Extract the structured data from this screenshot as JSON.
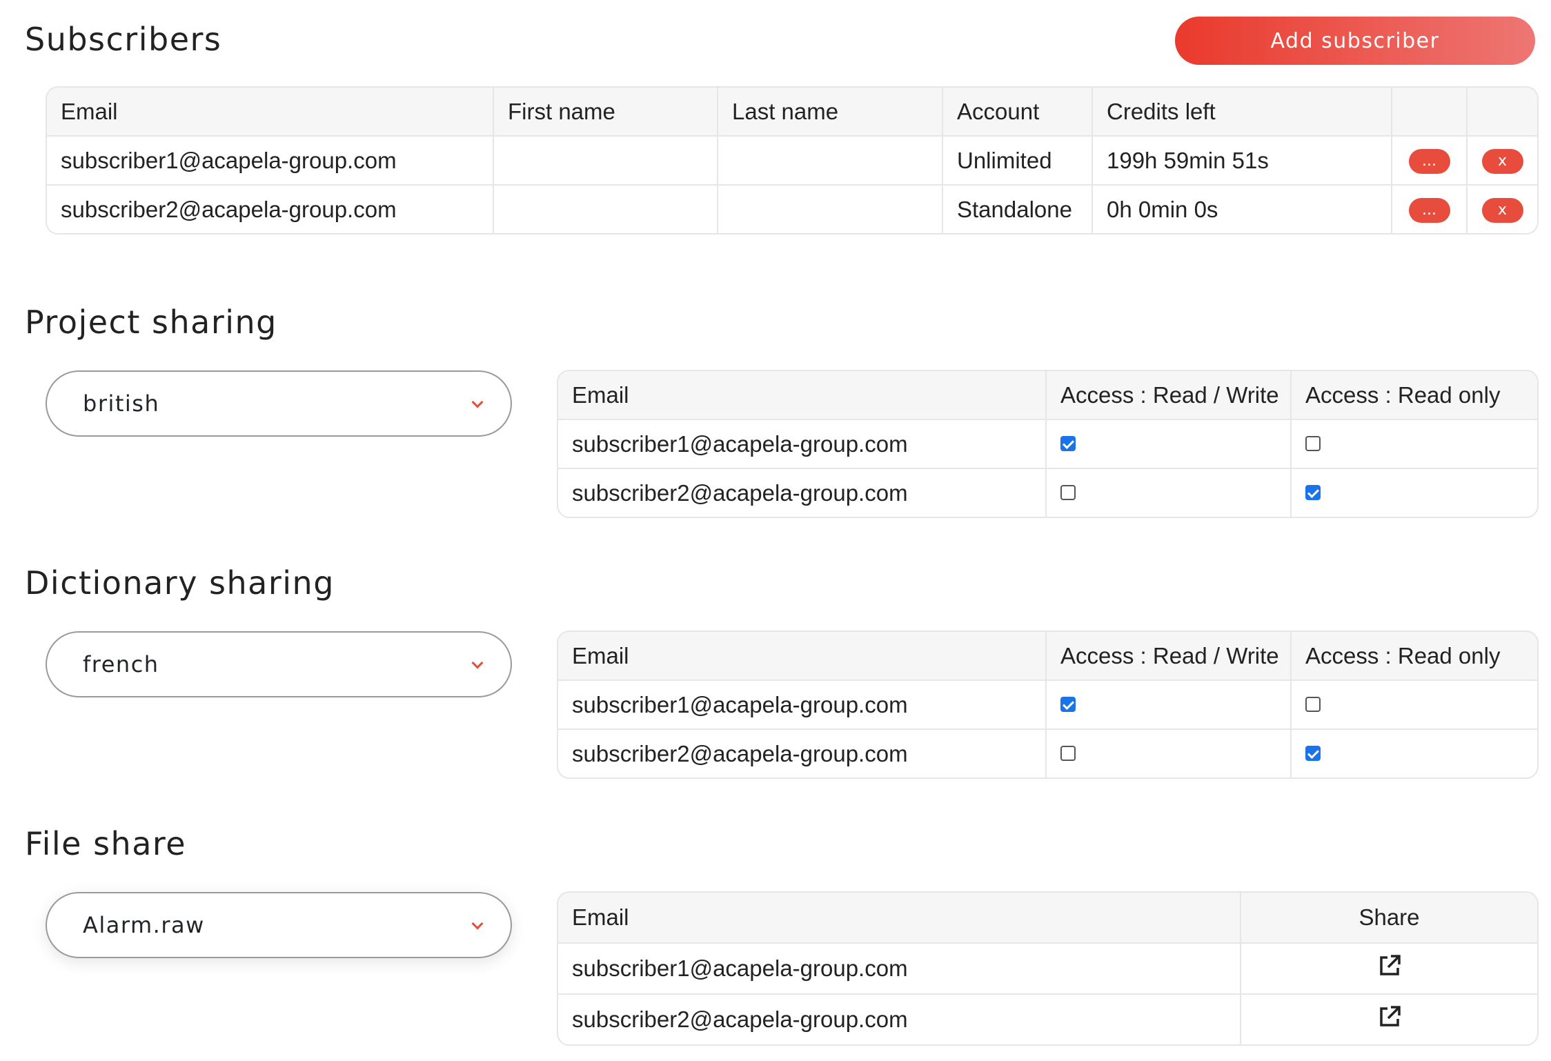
{
  "subscribers": {
    "title": "Subscribers",
    "add_button": "Add subscriber",
    "columns": [
      "Email",
      "First name",
      "Last name",
      "Account",
      "Credits left",
      "",
      ""
    ],
    "rows": [
      {
        "email": "subscriber1@acapela-group.com",
        "first_name": "",
        "last_name": "",
        "account": "Unlimited",
        "credits": "199h 59min 51s",
        "more_label": "...",
        "delete_label": "x"
      },
      {
        "email": "subscriber2@acapela-group.com",
        "first_name": "",
        "last_name": "",
        "account": "Standalone",
        "credits": "0h 0min 0s",
        "more_label": "...",
        "delete_label": "x"
      }
    ]
  },
  "project_sharing": {
    "title": "Project sharing",
    "selected": "british",
    "columns": [
      "Email",
      "Access : Read / Write",
      "Access : Read only"
    ],
    "rows": [
      {
        "email": "subscriber1@acapela-group.com",
        "read_write": true,
        "read_only": false
      },
      {
        "email": "subscriber2@acapela-group.com",
        "read_write": false,
        "read_only": true
      }
    ]
  },
  "dictionary_sharing": {
    "title": "Dictionary sharing",
    "selected": "french",
    "columns": [
      "Email",
      "Access : Read / Write",
      "Access : Read only"
    ],
    "rows": [
      {
        "email": "subscriber1@acapela-group.com",
        "read_write": true,
        "read_only": false
      },
      {
        "email": "subscriber2@acapela-group.com",
        "read_write": false,
        "read_only": true
      }
    ]
  },
  "file_share": {
    "title": "File share",
    "selected": "Alarm.raw",
    "columns": [
      "Email",
      "Share"
    ],
    "rows": [
      {
        "email": "subscriber1@acapela-group.com",
        "share_icon": "external-link-icon"
      },
      {
        "email": "subscriber2@acapela-group.com",
        "share_icon": "external-link-icon"
      }
    ]
  },
  "colors": {
    "accent": "#e74c3c",
    "checkbox_checked": "#1a73e8",
    "header_bg": "#f6f6f6",
    "border": "#e6e6e6"
  }
}
